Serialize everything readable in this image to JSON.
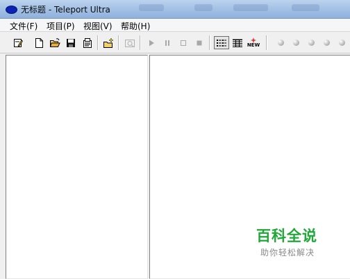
{
  "window": {
    "title": "无标题 - Teleport Ultra"
  },
  "menu": [
    {
      "label": "文件(F)"
    },
    {
      "label": "项目(P)"
    },
    {
      "label": "视图(V)"
    },
    {
      "label": "帮助(H)"
    }
  ],
  "toolbar": {
    "buttons": [
      {
        "name": "new-project-wizard",
        "icon": "edit-icon",
        "enabled": true
      },
      {
        "name": "new",
        "icon": "new-document-icon",
        "enabled": true
      },
      {
        "name": "open",
        "icon": "open-folder-icon",
        "enabled": true
      },
      {
        "name": "save",
        "icon": "save-icon",
        "enabled": true
      },
      {
        "name": "properties",
        "icon": "properties-icon",
        "enabled": true
      },
      {
        "name": "new-address",
        "icon": "new-folder-icon",
        "enabled": true
      },
      {
        "name": "browse-offline",
        "icon": "browse-icon",
        "enabled": false
      },
      {
        "name": "start",
        "icon": "play-icon",
        "enabled": false
      },
      {
        "name": "pause",
        "icon": "pause-icon",
        "enabled": false
      },
      {
        "name": "stop-gray",
        "icon": "stop-outline-icon",
        "enabled": false
      },
      {
        "name": "stop",
        "icon": "stop-icon",
        "enabled": false
      },
      {
        "name": "view-list",
        "icon": "list-view-icon",
        "enabled": true,
        "pressed": true
      },
      {
        "name": "view-details",
        "icon": "details-view-icon",
        "enabled": true
      },
      {
        "name": "whats-new",
        "icon": "new-badge-icon",
        "enabled": true
      }
    ],
    "new_badge": "NEW",
    "threads": 6
  },
  "watermark": {
    "title": "百科全说",
    "subtitle": "助你轻松解决"
  },
  "colors": {
    "title_icon": "#0c23b8",
    "watermark_green": "#1ea838"
  }
}
